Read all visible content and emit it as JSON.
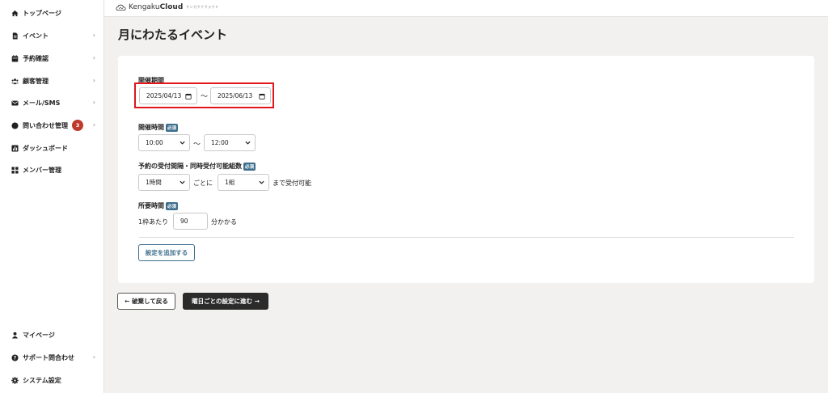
{
  "sidebar": {
    "items": [
      {
        "label": "トップページ",
        "icon": "home-icon"
      },
      {
        "label": "イベント",
        "icon": "document-icon"
      },
      {
        "label": "予約確認",
        "icon": "calendar-icon"
      },
      {
        "label": "顧客管理",
        "icon": "users-icon"
      },
      {
        "label": "メール/SMS",
        "icon": "mail-icon"
      },
      {
        "label": "問い合わせ管理",
        "icon": "chat-icon",
        "badge": "3"
      },
      {
        "label": "ダッシュボード",
        "icon": "chart-icon"
      },
      {
        "label": "メンバー管理",
        "icon": "grid-icon"
      }
    ],
    "bottom": [
      {
        "label": "マイページ",
        "icon": "person-icon"
      },
      {
        "label": "サポート問合わせ",
        "icon": "help-icon"
      },
      {
        "label": "システム設定",
        "icon": "gear-icon"
      }
    ]
  },
  "header": {
    "brand_light": "Kengaku",
    "brand_bold": "Cloud",
    "brand_sub": "ケンガクナクラウド"
  },
  "page": {
    "title": "月にわたるイベント"
  },
  "form": {
    "period_label": "開催期間",
    "start_date": "2025/04/13",
    "end_date": "2025/06/13",
    "tilde": "〜",
    "time_label": "開催時間",
    "required": "必須",
    "start_time": "10:00",
    "end_time": "12:00",
    "interval_label": "予約の受付間隔・同時受付可能組数",
    "interval_value": "1時間",
    "per_text": "ごとに",
    "groups_value": "1組",
    "accept_text": "まで受付可能",
    "duration_label": "所要時間",
    "per_slot_text": "1枠あたり",
    "duration_value": "90",
    "minutes_text": "分かかる",
    "add_button": "設定を追加する"
  },
  "footer": {
    "back_button": "← 破棄して戻る",
    "next_button": "曜日ごとの設定に進む →"
  },
  "colors": {
    "accent": "#3d6e8c",
    "highlight": "#e0161b",
    "badge": "#c0392b",
    "dark_button": "#2b2b2b"
  }
}
